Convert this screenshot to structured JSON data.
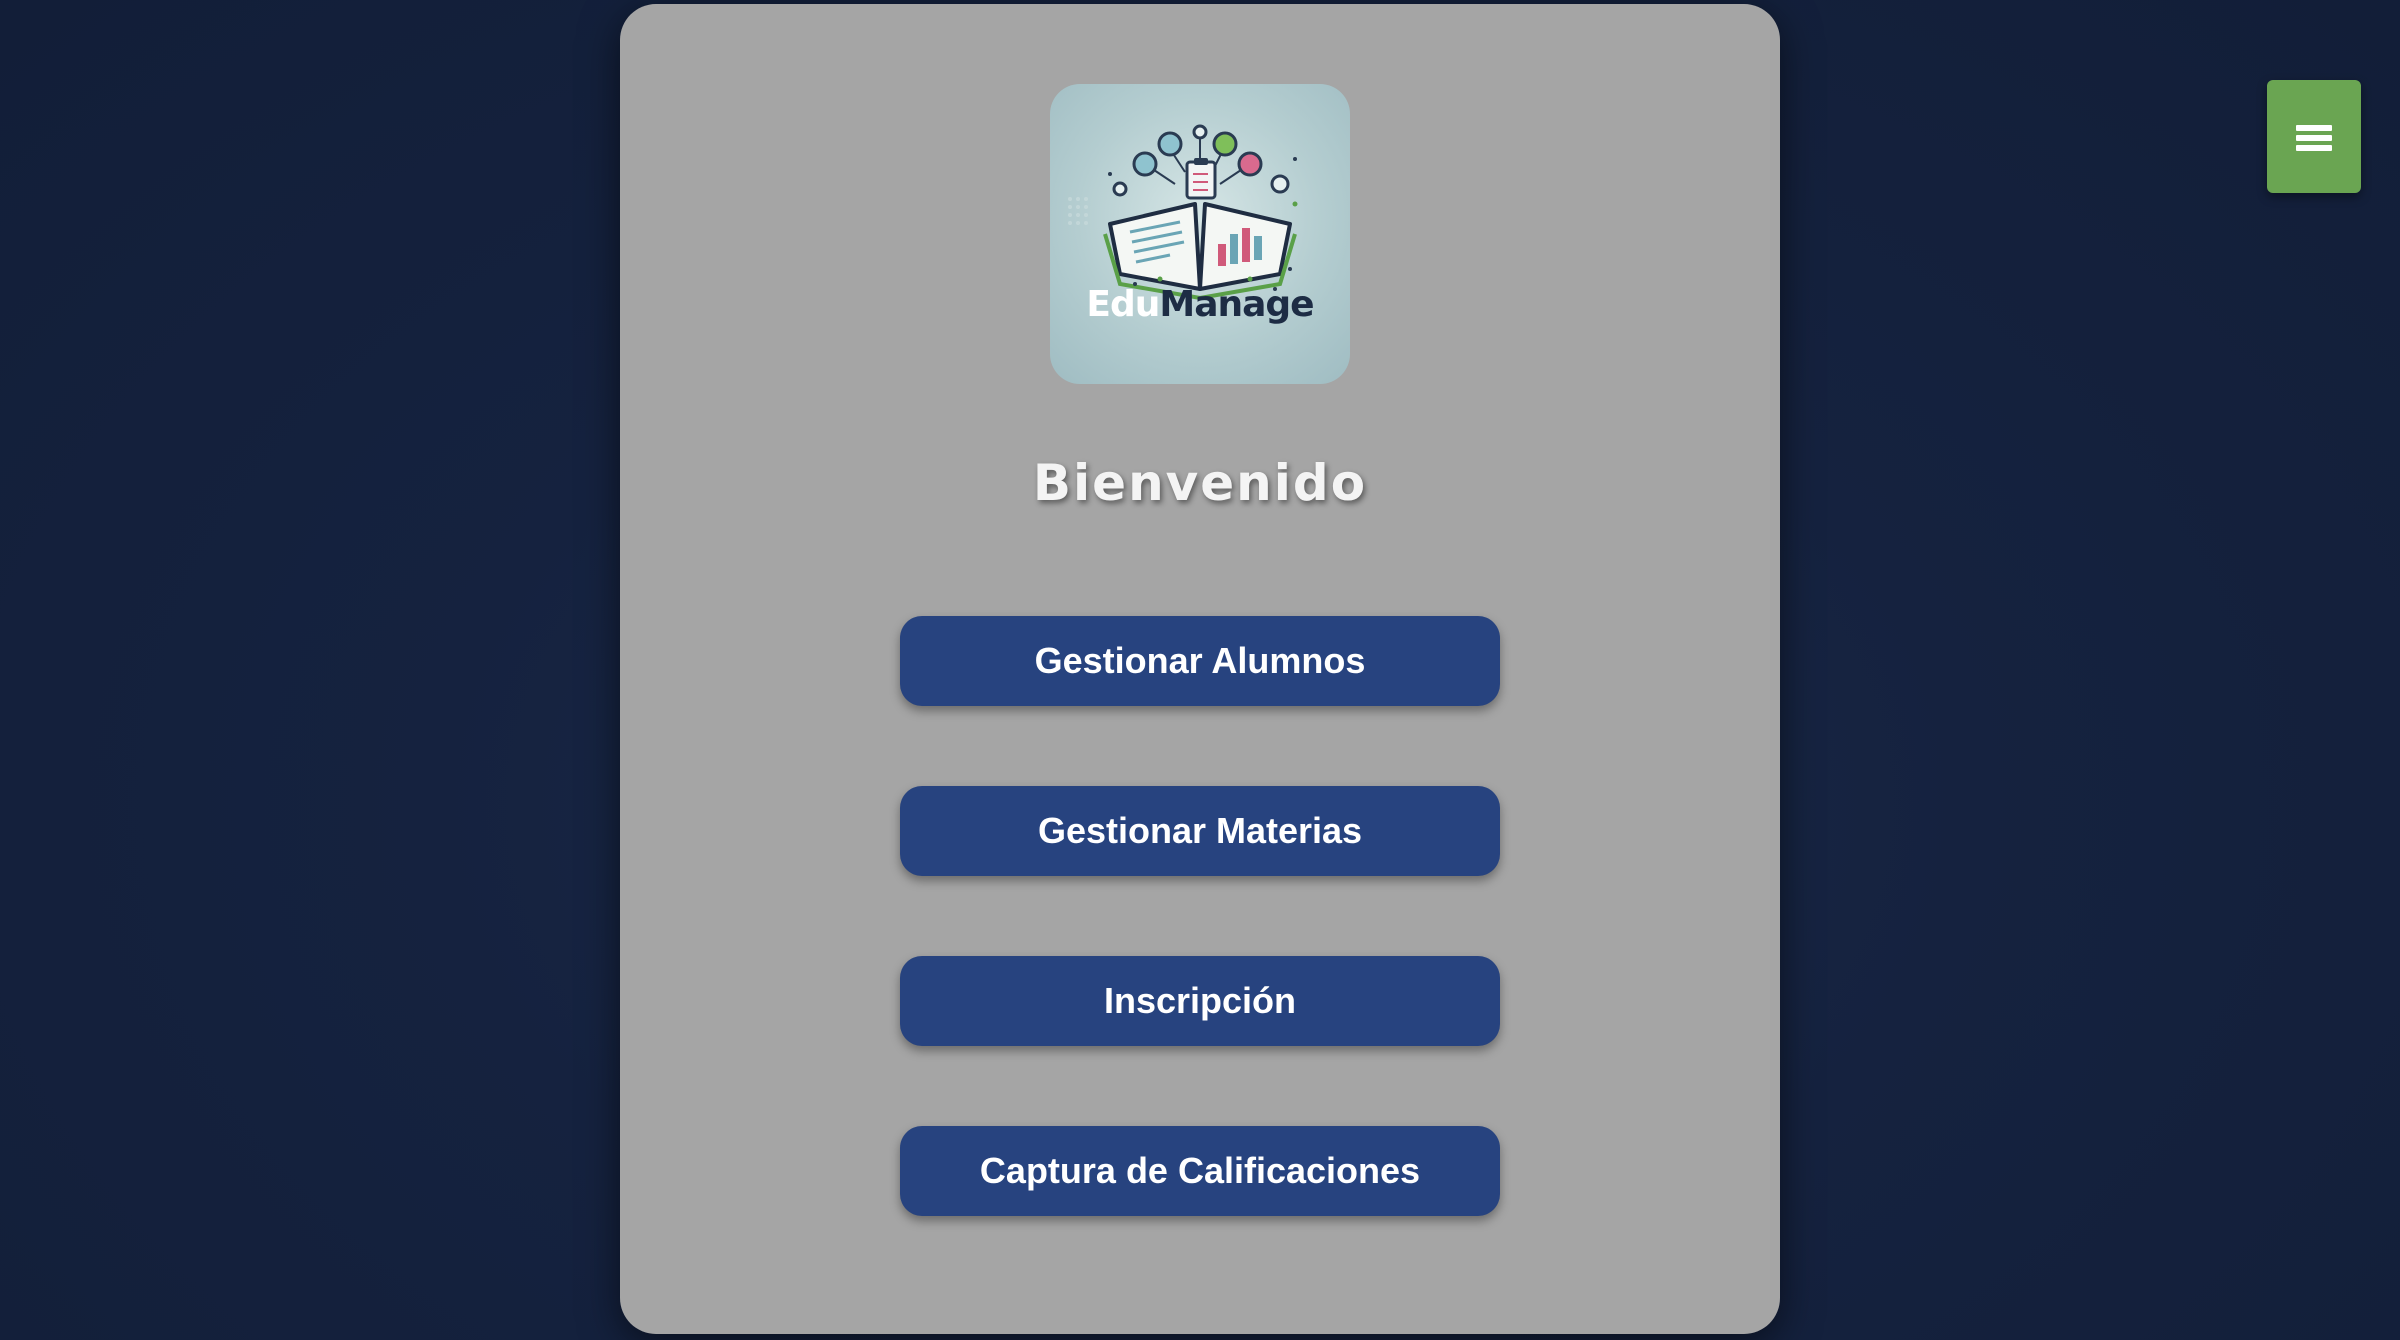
{
  "logo": {
    "brand_part1": "Edu",
    "brand_part2": "Manage",
    "icon": "open-book-with-charts-icon"
  },
  "welcome": {
    "title": "Bienvenido"
  },
  "menu": {
    "buttons": [
      {
        "label": "Gestionar Alumnos"
      },
      {
        "label": "Gestionar Materias"
      },
      {
        "label": "Inscripción"
      },
      {
        "label": "Captura de Calificaciones"
      }
    ]
  },
  "nav": {
    "menu_icon": "hamburger-menu-icon"
  },
  "colors": {
    "background": "#15223f",
    "panel": "#a5a5a5",
    "button": "#27437f",
    "menu_toggle": "#6aa552"
  }
}
